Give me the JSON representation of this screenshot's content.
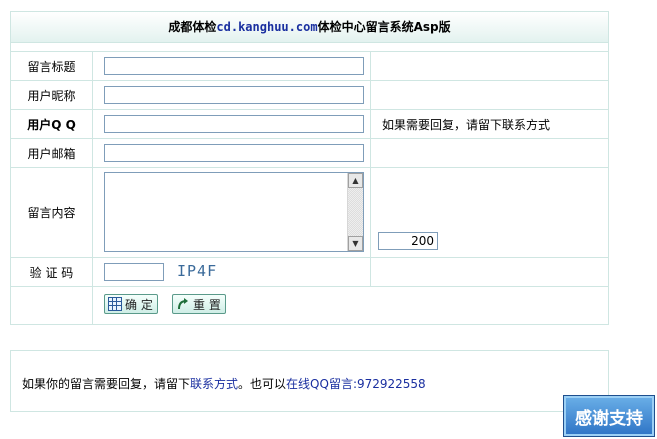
{
  "title": {
    "prefix": "成都体检",
    "domain": "cd.kanghuu.com",
    "suffix": "体检中心留言系统Asp版"
  },
  "form": {
    "subject_label": "留言标题",
    "subject_value": "",
    "nickname_label": "用户昵称",
    "nickname_value": "",
    "qq_label": "用户Q Q",
    "qq_value": "",
    "qq_hint": "如果需要回复，请留下联系方式",
    "email_label": "用户邮箱",
    "email_value": "",
    "content_label": "留言内容",
    "content_value": "",
    "char_counter": "200",
    "captcha_label": "验 证 码",
    "captcha_value": "",
    "captcha_code": "IP4F",
    "submit_label": "确 定",
    "reset_label": "重 置"
  },
  "footer": {
    "note_prefix": "如果你的留言需要回复，请留下",
    "note_link": "联系方式",
    "note_middle": "。也可以",
    "note_qq": "在线QQ留言:972922558"
  },
  "thanks_badge": "感谢支持"
}
